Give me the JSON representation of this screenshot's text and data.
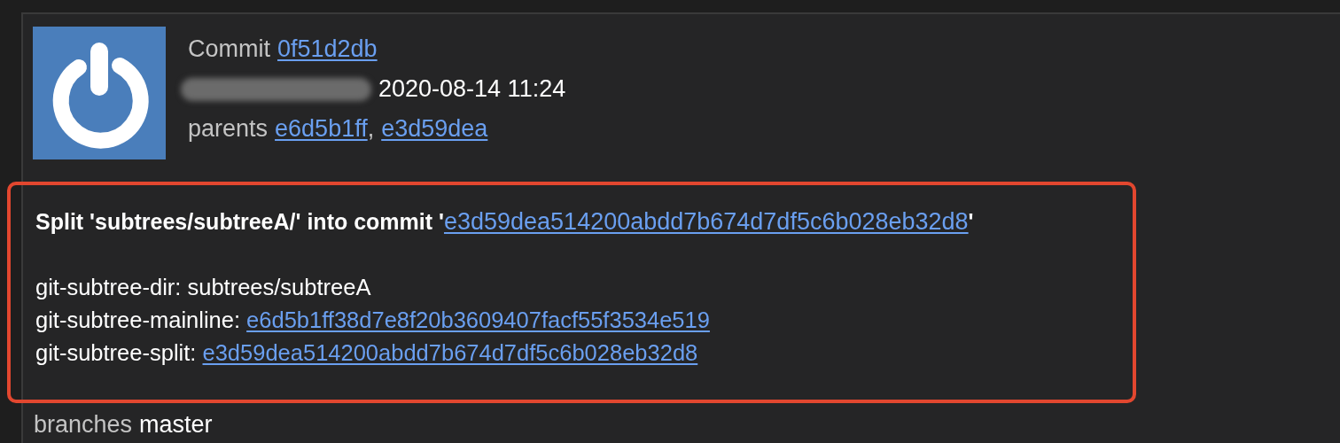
{
  "commit": {
    "label": "Commit",
    "hash": "0f51d2db",
    "date": "2020-08-14 11:24"
  },
  "parents": {
    "label": "parents",
    "hashes": [
      "e6d5b1ff",
      "e3d59dea"
    ],
    "separator": ","
  },
  "message": {
    "highlighted": true,
    "subject": {
      "before": "Split 'subtrees/subtreeA/' into commit '",
      "link": "e3d59dea514200abdd7b674d7df5c6b028eb32d8",
      "after": "'"
    },
    "trailers": [
      {
        "key": "git-subtree-dir:",
        "value": "subtrees/subtreeA",
        "kind": "text"
      },
      {
        "key": "git-subtree-mainline:",
        "value": "e6d5b1ff38d7e8f20b3609407facf55f3534e519",
        "kind": "link"
      },
      {
        "key": "git-subtree-split:",
        "value": "e3d59dea514200abdd7b674d7df5c6b028eb32d8",
        "kind": "link"
      }
    ]
  },
  "branches": {
    "label": "branches",
    "value": "master"
  }
}
